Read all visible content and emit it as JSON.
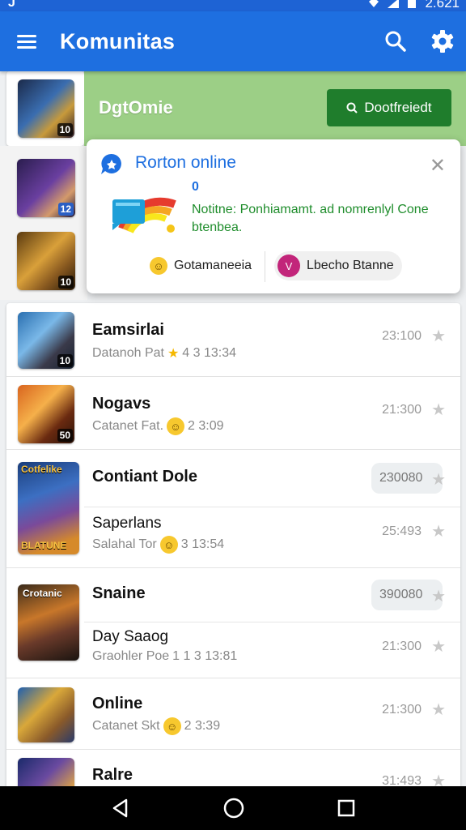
{
  "status": {
    "left": "J",
    "time": "2.621"
  },
  "appbar": {
    "title": "Komunitas"
  },
  "featured": {
    "badge": "10",
    "title": "DgtOmie",
    "button_label": "Dootfreiedt"
  },
  "side_badges": [
    "12",
    "10"
  ],
  "popup": {
    "title": "Rorton online",
    "zero": "0",
    "message": "Notitne: Ponhiamamt. ad nomrenlyl Cone btenbea.",
    "btn1": "Gotamaneeia",
    "btn2": "Lbecho Btanne"
  },
  "rows": [
    {
      "name": "Eamsirlai",
      "sub_prefix": "Datanoh Pat",
      "sub_value": "4 3 13:34",
      "value": "23:100",
      "badge": "10"
    },
    {
      "name": "Nogavs",
      "sub_prefix": "Catanet Fat.",
      "sub_value": "2 3:09",
      "value": "21:300",
      "badge": "50"
    },
    {
      "name": "Contiant Dole",
      "pill": "230080",
      "sub_name": "Saperlans",
      "sub_prefix": "Salahal Tor",
      "sub_value": "3 13:54",
      "value": "25:493",
      "cover_top": "Cotfelike",
      "cover_bottom": "BLATUNE"
    },
    {
      "name": "Snaine",
      "pill": "390080",
      "sub_name": "Day Saaog",
      "sub_prefix": "Graohler Poe",
      "sub_value": "1 1 3 13:81",
      "value": "21:300",
      "cover_top": "Crotanic"
    },
    {
      "name": "Online",
      "sub_prefix": "Catanet Skt",
      "sub_value": "2 3:39",
      "value": "21:300"
    },
    {
      "name": "Ralre",
      "value": "31:493"
    }
  ]
}
